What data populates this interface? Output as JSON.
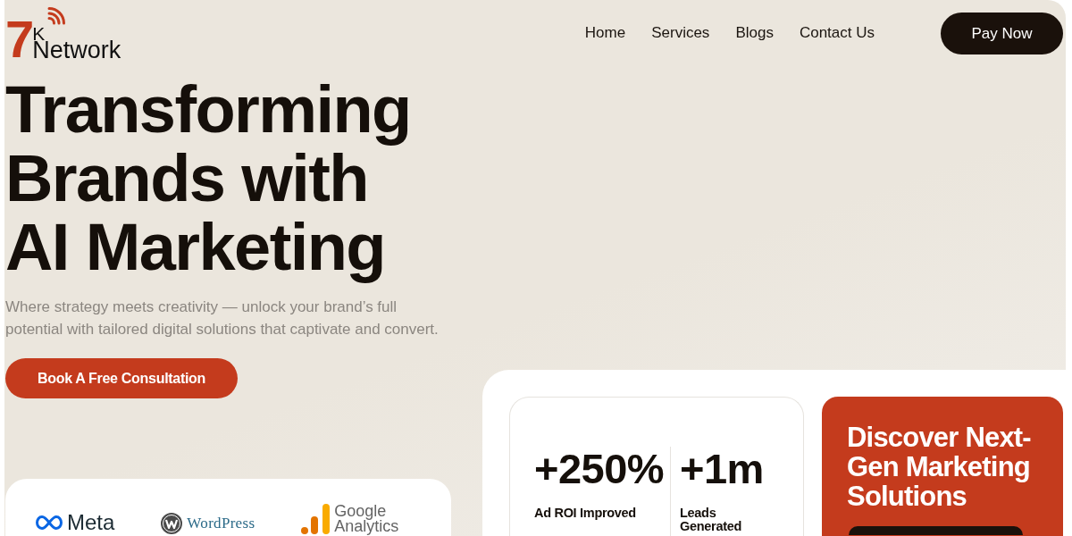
{
  "logo": {
    "numeral": "7",
    "letter": "K",
    "name": "Network"
  },
  "nav": {
    "links": [
      "Home",
      "Services",
      "Blogs",
      "Contact Us"
    ],
    "button": "Pay Now"
  },
  "hero": {
    "heading": "Transforming Brands with AI Marketing",
    "subtitle": "Where strategy meets creativity — unlock your brand’s full potential with tailored digital solutions that captivate and convert.",
    "cta": "Book A Free Consultation"
  },
  "partners": [
    {
      "kind": "meta",
      "name": "Meta"
    },
    {
      "kind": "wordpress",
      "name": "WordPress"
    },
    {
      "kind": "analytics",
      "name": "Google Analytics"
    }
  ],
  "stats": [
    {
      "value": "+250%",
      "label": "Ad ROI Improved"
    },
    {
      "value": "+1m",
      "label": "Leads Generated"
    }
  ],
  "promo": {
    "heading": "Discover Next-Gen Marketing Solutions"
  }
}
